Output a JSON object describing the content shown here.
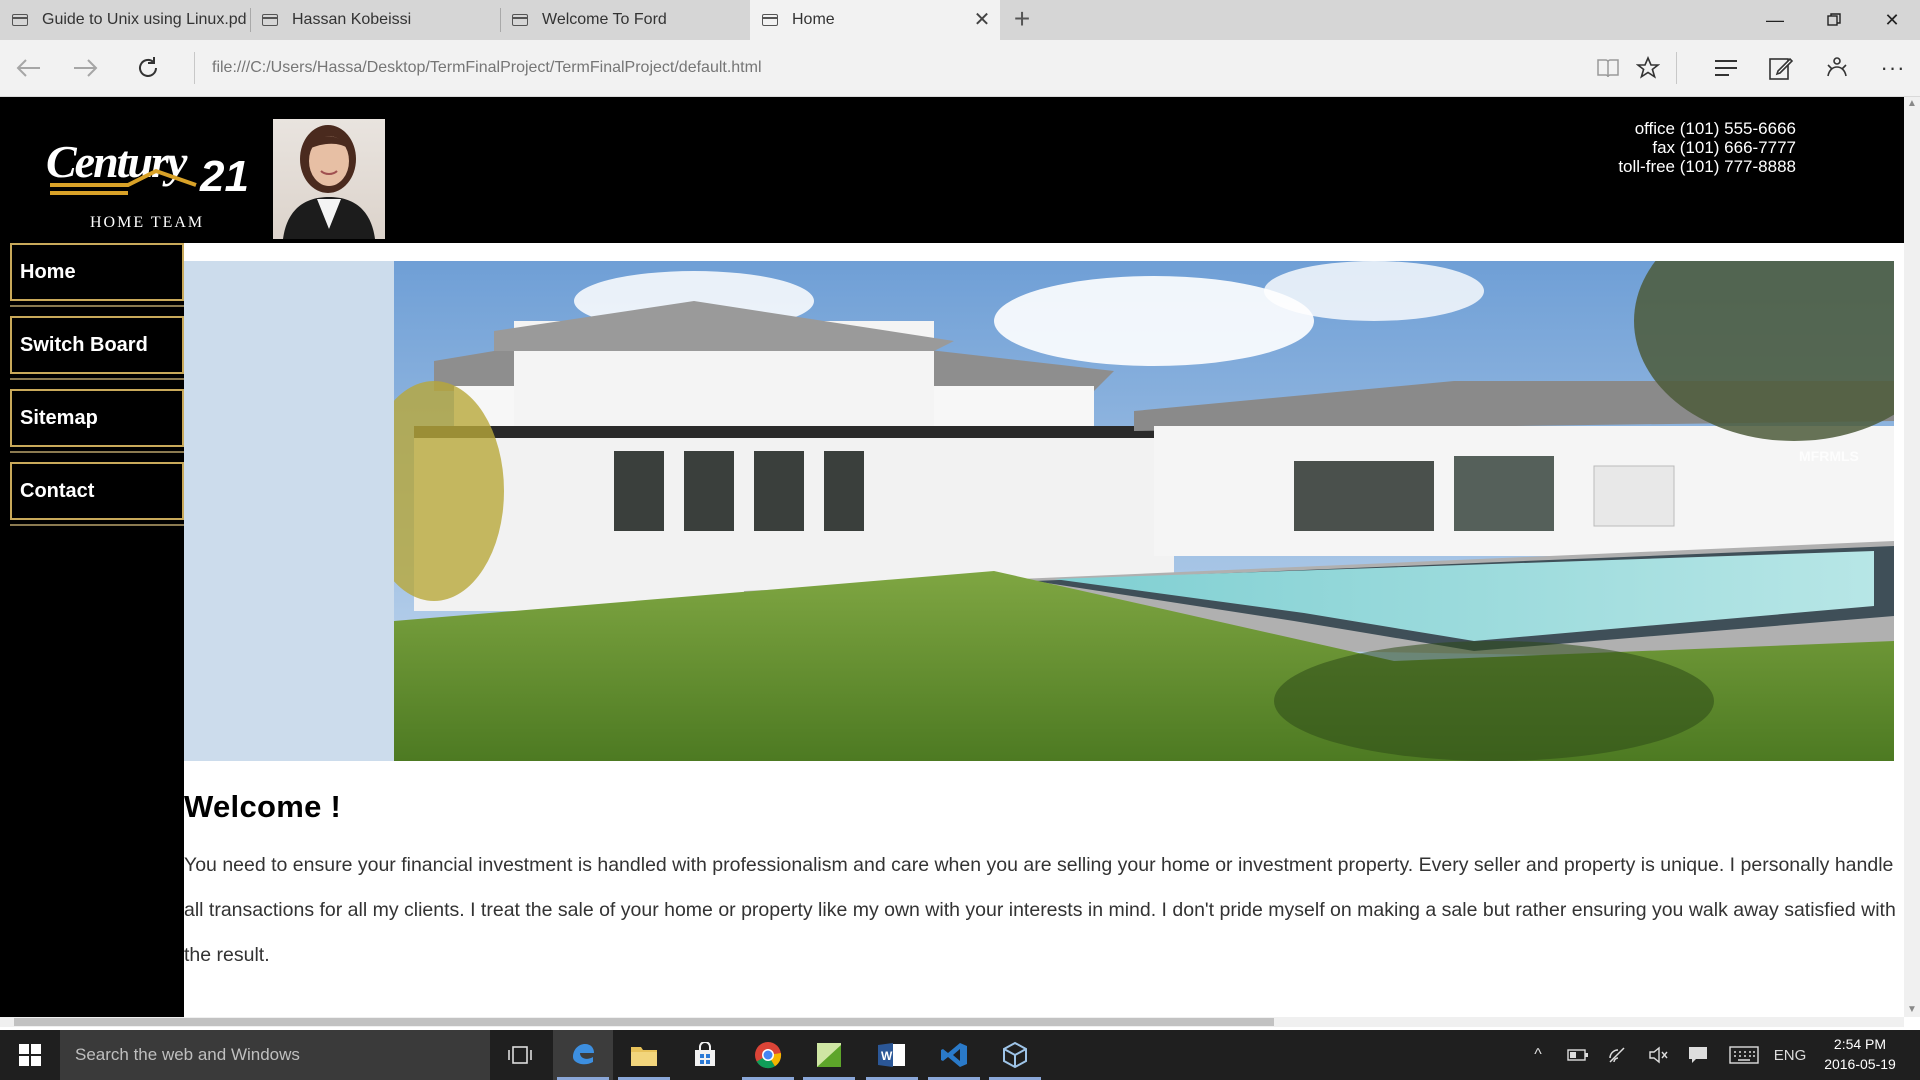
{
  "browser": {
    "tabs": [
      {
        "title": "Guide to Unix using Linux.pdf",
        "active": false
      },
      {
        "title": "Hassan Kobeissi",
        "active": false
      },
      {
        "title": "Welcome To Ford",
        "active": false
      },
      {
        "title": "Home",
        "active": true
      }
    ],
    "address": "file:///C:/Users/Hassa/Desktop/TermFinalProject/TermFinalProject/default.html",
    "icons": {
      "back": "back-arrow-icon",
      "forward": "forward-arrow-icon",
      "refresh": "refresh-icon",
      "reading_view": "reading-view-icon",
      "favorite": "star-icon",
      "hub": "hub-icon",
      "web_note": "web-note-icon",
      "share": "share-icon",
      "more": "more-icon"
    }
  },
  "page": {
    "brand": {
      "logo_word": "Century",
      "logo_number": "21",
      "logo_sub": "Home Team"
    },
    "contact": {
      "office": "office (101) 555-6666",
      "fax": "fax (101) 666-7777",
      "tollfree": "toll-free (101) 777-8888"
    },
    "nav": [
      {
        "label": "Home"
      },
      {
        "label": "Switch Board"
      },
      {
        "label": "Sitemap"
      },
      {
        "label": "Contact"
      }
    ],
    "hero_watermark": "MFRMLS",
    "welcome_heading": "Welcome !",
    "intro": "You need to ensure your financial investment is handled with professionalism and care when you are selling your home or investment property. Every seller and property is unique. I personally handle all transactions for all my clients. I treat the sale of your home or property like my own with your interests in mind. I don't pride myself on making a sale but rather ensuring you walk away satisfied with the result."
  },
  "taskbar": {
    "search_placeholder": "Search the web and Windows",
    "language": "ENG",
    "time": "2:54 PM",
    "date": "2016-05-19"
  },
  "colors": {
    "accent_gold": "#c9a95a",
    "hero_side_blue": "#ccdcec",
    "taskbar": "#1f1f1f"
  }
}
